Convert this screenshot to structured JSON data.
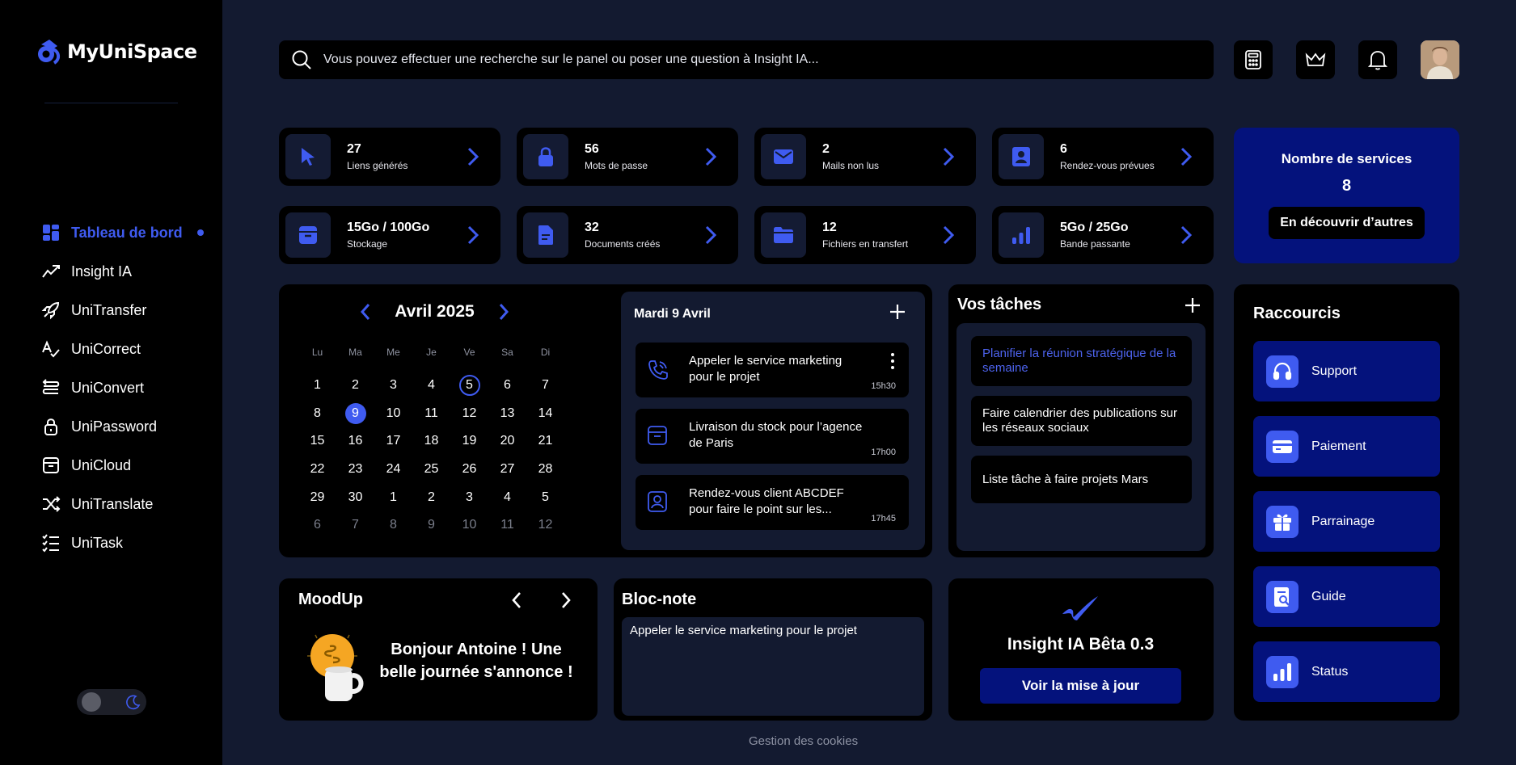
{
  "brand": {
    "name": "MyUniSpace",
    "accent": "#3f5bf0",
    "panel_blue": "#04127c"
  },
  "sidebar": {
    "items": [
      {
        "label": "Tableau de bord",
        "icon": "dashboard-icon",
        "active": true
      },
      {
        "label": "Insight IA",
        "icon": "insight-icon"
      },
      {
        "label": "UniTransfer",
        "icon": "rocket-icon"
      },
      {
        "label": "UniCorrect",
        "icon": "correct-icon"
      },
      {
        "label": "UniConvert",
        "icon": "convert-icon"
      },
      {
        "label": "UniPassword",
        "icon": "lock-icon"
      },
      {
        "label": "UniCloud",
        "icon": "archive-icon"
      },
      {
        "label": "UniTranslate",
        "icon": "shuffle-icon"
      },
      {
        "label": "UniTask",
        "icon": "checklist-icon"
      }
    ]
  },
  "search": {
    "placeholder": "Vous pouvez effectuer une recherche sur le panel ou poser une question à Insight IA..."
  },
  "stats": [
    {
      "value": "27",
      "label": "Liens générés",
      "icon": "cursor-icon"
    },
    {
      "value": "56",
      "label": "Mots de passe",
      "icon": "lock-icon"
    },
    {
      "value": "2",
      "label": "Mails non lus",
      "icon": "mail-icon"
    },
    {
      "value": "6",
      "label": "Rendez-vous prévues",
      "icon": "contact-icon"
    },
    {
      "value": "15Go / 100Go",
      "label": "Stockage",
      "icon": "archive-icon"
    },
    {
      "value": "32",
      "label": "Documents créés",
      "icon": "document-icon"
    },
    {
      "value": "12",
      "label": "Fichiers en transfert",
      "icon": "folder-icon"
    },
    {
      "value": "5Go / 25Go",
      "label": "Bande passante",
      "icon": "bars-icon"
    }
  ],
  "services": {
    "title": "Nombre de services",
    "count": "8",
    "button": "En découvrir d’autres"
  },
  "calendar": {
    "month": "Avril 2025",
    "weekdays": [
      "Lu",
      "Ma",
      "Me",
      "Je",
      "Ve",
      "Sa",
      "Di"
    ],
    "days": [
      "1",
      "2",
      "3",
      "4",
      "5",
      "6",
      "7",
      "8",
      "9",
      "10",
      "11",
      "12",
      "13",
      "14",
      "15",
      "16",
      "17",
      "18",
      "19",
      "20",
      "21",
      "22",
      "23",
      "24",
      "25",
      "26",
      "27",
      "28",
      "29",
      "30",
      "1",
      "2",
      "3",
      "4",
      "5",
      "6",
      "7",
      "8",
      "9",
      "10",
      "11",
      "12"
    ],
    "today": "9",
    "marked": "5"
  },
  "agenda": {
    "title": "Mardi 9 Avril",
    "events": [
      {
        "text": "Appeler le service marketing pour le projet",
        "time": "15h30",
        "icon": "phone-icon"
      },
      {
        "text": "Livraison du stock pour l’agence de Paris",
        "time": "17h00",
        "icon": "archive-icon"
      },
      {
        "text": "Rendez-vous client ABCDEF pour faire le point sur les...",
        "time": "17h45",
        "icon": "contact-icon"
      }
    ]
  },
  "tasks": {
    "title": "Vos tâches",
    "items": [
      "Planifier la réunion stratégique de la semaine",
      "Faire calendrier des publications sur les réseaux sociaux",
      "Liste tâche à faire projets Mars"
    ]
  },
  "shortcuts": {
    "title": "Raccourcis",
    "items": [
      {
        "label": "Support",
        "icon": "headset-icon"
      },
      {
        "label": "Paiement",
        "icon": "card-icon"
      },
      {
        "label": "Parrainage",
        "icon": "gift-icon"
      },
      {
        "label": "Guide",
        "icon": "guide-icon"
      },
      {
        "label": "Status",
        "icon": "bars-icon"
      }
    ]
  },
  "mood": {
    "title": "MoodUp",
    "greeting": "Bonjour Antoine ! Une belle journée s'annonce !"
  },
  "note": {
    "title": "Bloc-note",
    "content": "Appeler le service marketing pour le projet"
  },
  "insight": {
    "title": "Insight IA Bêta 0.3",
    "button": "Voir la mise à jour"
  },
  "footer": {
    "cookies": "Gestion des cookies"
  }
}
